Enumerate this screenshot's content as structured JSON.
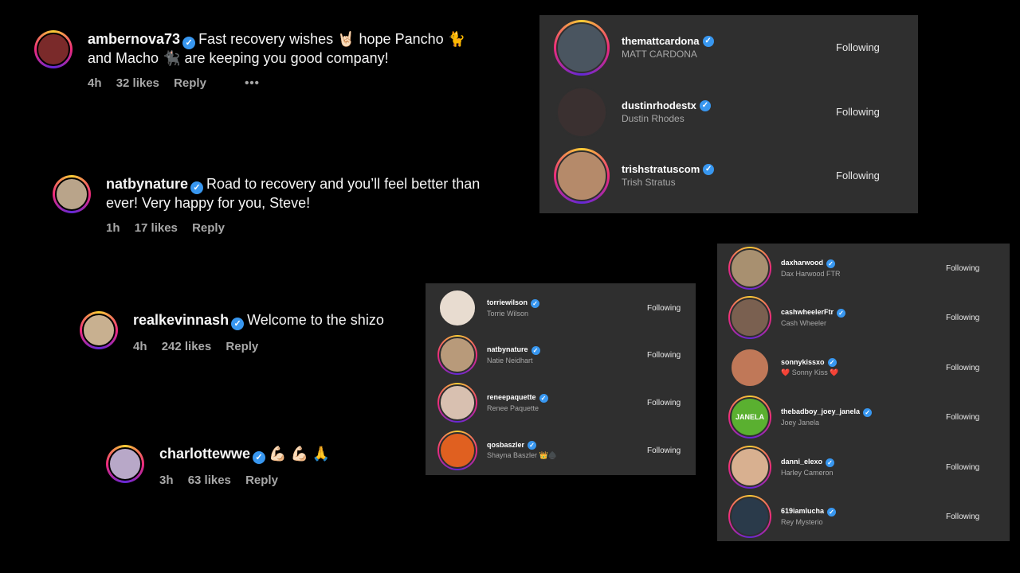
{
  "comments": [
    {
      "user": "ambernova73",
      "text": "Fast recovery wishes 🤘🏻 hope Pancho 🐈 and Macho 🐈‍⬛ are keeping you good company!",
      "time": "4h",
      "likes": "32 likes",
      "reply": "Reply",
      "more": "•••",
      "avatar_color": "#7a2a2a"
    },
    {
      "user": "natbynature",
      "text": "Road to recovery and you’ll feel better than ever! Very happy for you, Steve!",
      "time": "1h",
      "likes": "17 likes",
      "reply": "Reply",
      "avatar_color": "#b9a48a"
    },
    {
      "user": "realkevinnash",
      "text": "Welcome to the shizo",
      "time": "4h",
      "likes": "242 likes",
      "reply": "Reply",
      "avatar_color": "#c8b090"
    },
    {
      "user": "charlottewwe",
      "text": "💪🏻 💪🏻 🙏",
      "time": "3h",
      "likes": "63 likes",
      "reply": "Reply",
      "avatar_color": "#b8a8c8"
    }
  ],
  "panel_a": {
    "rows": [
      {
        "username": "themattcardona",
        "fullname": "MATT CARDONA",
        "button": "Following",
        "avatar_color": "#4a5560"
      },
      {
        "username": "dustinrhodestx",
        "fullname": "Dustin Rhodes",
        "button": "Following",
        "avatar_color": "#3a3030"
      },
      {
        "username": "trishstratuscom",
        "fullname": "Trish Stratus",
        "button": "Following",
        "avatar_color": "#b58a6a"
      }
    ]
  },
  "panel_b": {
    "rows": [
      {
        "username": "torriewilson",
        "fullname": "Torrie Wilson",
        "button": "Following",
        "avatar_color": "#e8dcd0"
      },
      {
        "username": "natbynature",
        "fullname": "Natie Neidhart",
        "button": "Following",
        "avatar_color": "#b89a7a"
      },
      {
        "username": "reneepaquette",
        "fullname": "Renee Paquette",
        "button": "Following",
        "avatar_color": "#d8c0b0"
      },
      {
        "username": "qosbaszler",
        "fullname": "Shayna Baszler 👑♠️",
        "button": "Following",
        "avatar_color": "#e06020"
      }
    ]
  },
  "panel_c": {
    "rows": [
      {
        "username": "daxharwood",
        "fullname": "Dax Harwood FTR",
        "button": "Following",
        "avatar_color": "#a89070"
      },
      {
        "username": "cashwheelerFtr",
        "fullname": "Cash Wheeler",
        "button": "Following",
        "avatar_color": "#7a6050"
      },
      {
        "username": "sonnykissxo",
        "fullname": "❤️ Sonny Kiss ❤️",
        "button": "Following",
        "avatar_color": "#c07858"
      },
      {
        "username": "thebadboy_joey_janela",
        "fullname": "Joey Janela",
        "button": "Following",
        "avatar_color": "#5ab030",
        "logo_text": "JANELA"
      },
      {
        "username": "danni_elexo",
        "fullname": "Harley Cameron",
        "button": "Following",
        "avatar_color": "#d8b090"
      },
      {
        "username": "619iamlucha",
        "fullname": "Rey Mysterio",
        "button": "Following",
        "avatar_color": "#2a3a4a"
      }
    ]
  },
  "verified_glyph": "✓"
}
